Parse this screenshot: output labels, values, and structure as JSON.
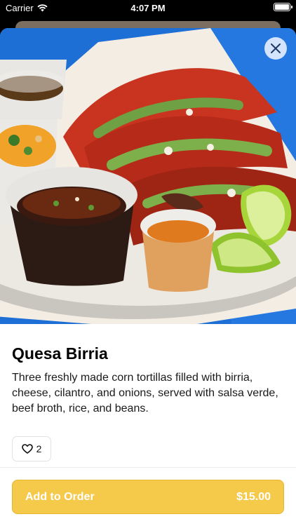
{
  "status_bar": {
    "carrier": "Carrier",
    "time": "4:07 PM"
  },
  "item": {
    "title": "Quesa Birria",
    "description": "Three freshly made corn tortillas filled with birria, cheese, cilantro, and onions, served with salsa verde, beef broth, rice, and beans.",
    "like_count": "2"
  },
  "cta": {
    "label": "Add to Order",
    "price": "$15.00"
  },
  "colors": {
    "accent": "#f5c94a",
    "hero_bg": "#1d6fd6",
    "close_bg": "#d4e4ff"
  },
  "icons": {
    "close": "close-icon",
    "like": "heart-outline-icon",
    "wifi": "wifi-icon",
    "battery": "battery-icon"
  }
}
